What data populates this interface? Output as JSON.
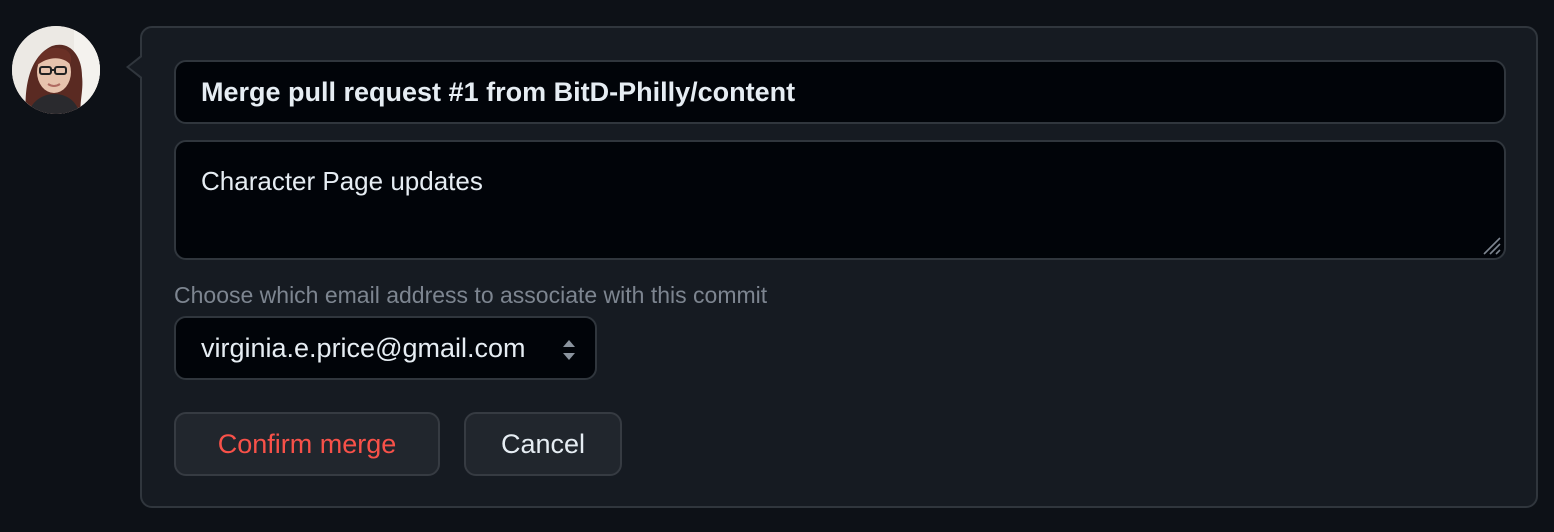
{
  "commit": {
    "title_value": "Merge pull request #1 from BitD-Philly/content",
    "body_value": "Character Page updates"
  },
  "email": {
    "label": "Choose which email address to associate with this commit",
    "selected": "virginia.e.price@gmail.com"
  },
  "actions": {
    "confirm_label": "Confirm merge",
    "cancel_label": "Cancel"
  },
  "colors": {
    "background": "#0d1117",
    "panel": "#161b22",
    "border": "#30363d",
    "input_bg": "#010409",
    "text": "#e6edf3",
    "muted": "#7d8590",
    "danger": "#f85149",
    "button_bg": "#21262d"
  }
}
